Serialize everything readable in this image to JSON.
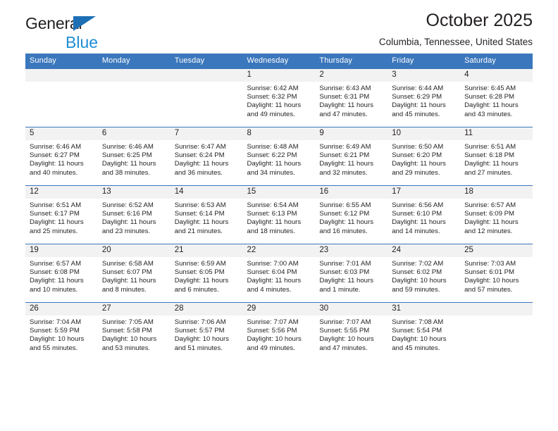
{
  "brand": {
    "line1": "General",
    "line2": "Blue",
    "triangle_color": "#1c6fb5",
    "blue_color": "#1f8ed6"
  },
  "header": {
    "title": "October 2025",
    "subtitle": "Columbia, Tennessee, United States",
    "header_bg": "#3b77bc",
    "daynum_bg": "#f2f2f2"
  },
  "calendar": {
    "weekday_headers": [
      "Sunday",
      "Monday",
      "Tuesday",
      "Wednesday",
      "Thursday",
      "Friday",
      "Saturday"
    ],
    "weeks": [
      [
        {
          "day": "",
          "empty": true
        },
        {
          "day": "",
          "empty": true
        },
        {
          "day": "",
          "empty": true
        },
        {
          "day": "1",
          "sunrise": "Sunrise: 6:42 AM",
          "sunset": "Sunset: 6:32 PM",
          "daylight1": "Daylight: 11 hours",
          "daylight2": "and 49 minutes."
        },
        {
          "day": "2",
          "sunrise": "Sunrise: 6:43 AM",
          "sunset": "Sunset: 6:31 PM",
          "daylight1": "Daylight: 11 hours",
          "daylight2": "and 47 minutes."
        },
        {
          "day": "3",
          "sunrise": "Sunrise: 6:44 AM",
          "sunset": "Sunset: 6:29 PM",
          "daylight1": "Daylight: 11 hours",
          "daylight2": "and 45 minutes."
        },
        {
          "day": "4",
          "sunrise": "Sunrise: 6:45 AM",
          "sunset": "Sunset: 6:28 PM",
          "daylight1": "Daylight: 11 hours",
          "daylight2": "and 43 minutes."
        }
      ],
      [
        {
          "day": "5",
          "sunrise": "Sunrise: 6:46 AM",
          "sunset": "Sunset: 6:27 PM",
          "daylight1": "Daylight: 11 hours",
          "daylight2": "and 40 minutes."
        },
        {
          "day": "6",
          "sunrise": "Sunrise: 6:46 AM",
          "sunset": "Sunset: 6:25 PM",
          "daylight1": "Daylight: 11 hours",
          "daylight2": "and 38 minutes."
        },
        {
          "day": "7",
          "sunrise": "Sunrise: 6:47 AM",
          "sunset": "Sunset: 6:24 PM",
          "daylight1": "Daylight: 11 hours",
          "daylight2": "and 36 minutes."
        },
        {
          "day": "8",
          "sunrise": "Sunrise: 6:48 AM",
          "sunset": "Sunset: 6:22 PM",
          "daylight1": "Daylight: 11 hours",
          "daylight2": "and 34 minutes."
        },
        {
          "day": "9",
          "sunrise": "Sunrise: 6:49 AM",
          "sunset": "Sunset: 6:21 PM",
          "daylight1": "Daylight: 11 hours",
          "daylight2": "and 32 minutes."
        },
        {
          "day": "10",
          "sunrise": "Sunrise: 6:50 AM",
          "sunset": "Sunset: 6:20 PM",
          "daylight1": "Daylight: 11 hours",
          "daylight2": "and 29 minutes."
        },
        {
          "day": "11",
          "sunrise": "Sunrise: 6:51 AM",
          "sunset": "Sunset: 6:18 PM",
          "daylight1": "Daylight: 11 hours",
          "daylight2": "and 27 minutes."
        }
      ],
      [
        {
          "day": "12",
          "sunrise": "Sunrise: 6:51 AM",
          "sunset": "Sunset: 6:17 PM",
          "daylight1": "Daylight: 11 hours",
          "daylight2": "and 25 minutes."
        },
        {
          "day": "13",
          "sunrise": "Sunrise: 6:52 AM",
          "sunset": "Sunset: 6:16 PM",
          "daylight1": "Daylight: 11 hours",
          "daylight2": "and 23 minutes."
        },
        {
          "day": "14",
          "sunrise": "Sunrise: 6:53 AM",
          "sunset": "Sunset: 6:14 PM",
          "daylight1": "Daylight: 11 hours",
          "daylight2": "and 21 minutes."
        },
        {
          "day": "15",
          "sunrise": "Sunrise: 6:54 AM",
          "sunset": "Sunset: 6:13 PM",
          "daylight1": "Daylight: 11 hours",
          "daylight2": "and 18 minutes."
        },
        {
          "day": "16",
          "sunrise": "Sunrise: 6:55 AM",
          "sunset": "Sunset: 6:12 PM",
          "daylight1": "Daylight: 11 hours",
          "daylight2": "and 16 minutes."
        },
        {
          "day": "17",
          "sunrise": "Sunrise: 6:56 AM",
          "sunset": "Sunset: 6:10 PM",
          "daylight1": "Daylight: 11 hours",
          "daylight2": "and 14 minutes."
        },
        {
          "day": "18",
          "sunrise": "Sunrise: 6:57 AM",
          "sunset": "Sunset: 6:09 PM",
          "daylight1": "Daylight: 11 hours",
          "daylight2": "and 12 minutes."
        }
      ],
      [
        {
          "day": "19",
          "sunrise": "Sunrise: 6:57 AM",
          "sunset": "Sunset: 6:08 PM",
          "daylight1": "Daylight: 11 hours",
          "daylight2": "and 10 minutes."
        },
        {
          "day": "20",
          "sunrise": "Sunrise: 6:58 AM",
          "sunset": "Sunset: 6:07 PM",
          "daylight1": "Daylight: 11 hours",
          "daylight2": "and 8 minutes."
        },
        {
          "day": "21",
          "sunrise": "Sunrise: 6:59 AM",
          "sunset": "Sunset: 6:05 PM",
          "daylight1": "Daylight: 11 hours",
          "daylight2": "and 6 minutes."
        },
        {
          "day": "22",
          "sunrise": "Sunrise: 7:00 AM",
          "sunset": "Sunset: 6:04 PM",
          "daylight1": "Daylight: 11 hours",
          "daylight2": "and 4 minutes."
        },
        {
          "day": "23",
          "sunrise": "Sunrise: 7:01 AM",
          "sunset": "Sunset: 6:03 PM",
          "daylight1": "Daylight: 11 hours",
          "daylight2": "and 1 minute."
        },
        {
          "day": "24",
          "sunrise": "Sunrise: 7:02 AM",
          "sunset": "Sunset: 6:02 PM",
          "daylight1": "Daylight: 10 hours",
          "daylight2": "and 59 minutes."
        },
        {
          "day": "25",
          "sunrise": "Sunrise: 7:03 AM",
          "sunset": "Sunset: 6:01 PM",
          "daylight1": "Daylight: 10 hours",
          "daylight2": "and 57 minutes."
        }
      ],
      [
        {
          "day": "26",
          "sunrise": "Sunrise: 7:04 AM",
          "sunset": "Sunset: 5:59 PM",
          "daylight1": "Daylight: 10 hours",
          "daylight2": "and 55 minutes."
        },
        {
          "day": "27",
          "sunrise": "Sunrise: 7:05 AM",
          "sunset": "Sunset: 5:58 PM",
          "daylight1": "Daylight: 10 hours",
          "daylight2": "and 53 minutes."
        },
        {
          "day": "28",
          "sunrise": "Sunrise: 7:06 AM",
          "sunset": "Sunset: 5:57 PM",
          "daylight1": "Daylight: 10 hours",
          "daylight2": "and 51 minutes."
        },
        {
          "day": "29",
          "sunrise": "Sunrise: 7:07 AM",
          "sunset": "Sunset: 5:56 PM",
          "daylight1": "Daylight: 10 hours",
          "daylight2": "and 49 minutes."
        },
        {
          "day": "30",
          "sunrise": "Sunrise: 7:07 AM",
          "sunset": "Sunset: 5:55 PM",
          "daylight1": "Daylight: 10 hours",
          "daylight2": "and 47 minutes."
        },
        {
          "day": "31",
          "sunrise": "Sunrise: 7:08 AM",
          "sunset": "Sunset: 5:54 PM",
          "daylight1": "Daylight: 10 hours",
          "daylight2": "and 45 minutes."
        },
        {
          "day": "",
          "empty": true
        }
      ]
    ]
  }
}
